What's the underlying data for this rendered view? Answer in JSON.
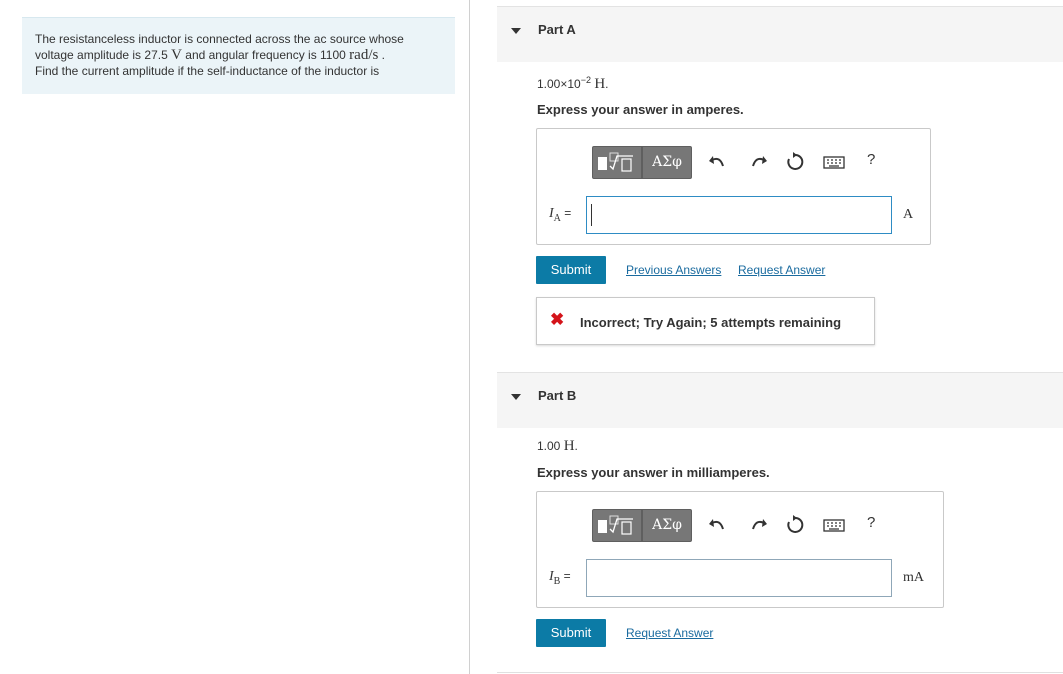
{
  "problem": {
    "line1": "The resistanceless inductor is connected across the ac source whose",
    "line2_pre": "voltage amplitude is 27.5 ",
    "voltage_unit": "V",
    "line2_mid": " and angular frequency is 1100 ",
    "freq_unit": "rad/s",
    "line2_end": " .",
    "line3": "Find the current amplitude if the self-inductance of the inductor is"
  },
  "partA": {
    "title": "Part A",
    "given_mantissa": "1.00×10",
    "given_exp": "−2",
    "given_unit": "H",
    "given_end": ".",
    "instruction": "Express your answer in amperes.",
    "label_symbol": "I",
    "label_sub": "A",
    "label_eq": " =",
    "input_value": "",
    "unit": "A",
    "submit_label": "Submit",
    "previous_answers_label": "Previous Answers",
    "request_answer_label": "Request Answer",
    "feedback_icon": "✖",
    "feedback_text": "Incorrect; Try Again; 5 attempts remaining"
  },
  "partB": {
    "title": "Part B",
    "given_value": "1.00 ",
    "given_unit": "H",
    "given_end": ".",
    "instruction": "Express your answer in milliamperes.",
    "label_symbol": "I",
    "label_sub": "B",
    "label_eq": " =",
    "input_value": "",
    "unit": "mA",
    "submit_label": "Submit",
    "request_answer_label": "Request Answer"
  },
  "toolbar": {
    "greek_label": "ΑΣφ",
    "help_label": "?",
    "icons": [
      "templates-icon",
      "greek-letters-icon",
      "undo-icon",
      "redo-icon",
      "reset-icon",
      "keyboard-icon",
      "help-icon"
    ]
  },
  "colors": {
    "problem_bg": "#ebf4f8",
    "submit_bg": "#0c7ba6",
    "link": "#1a6b9f",
    "error": "#d4141a"
  }
}
